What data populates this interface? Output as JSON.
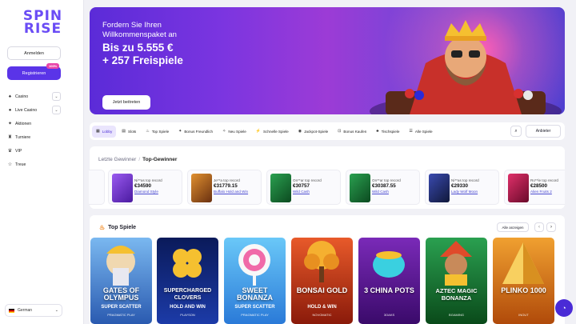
{
  "brand": {
    "line1": "SPIN",
    "line2": "RISE"
  },
  "auth": {
    "login": "Anmelden",
    "register": "Registrieren",
    "register_badge": "100%"
  },
  "nav": [
    {
      "label": "Casino",
      "icon": "spade-icon",
      "expand": true
    },
    {
      "label": "Live Casino",
      "icon": "live-icon",
      "expand": true
    },
    {
      "label": "Aktionen",
      "icon": "gift-icon",
      "expand": false
    },
    {
      "label": "Turniere",
      "icon": "trophy-icon",
      "expand": false
    },
    {
      "label": "VIP",
      "icon": "crown-icon",
      "expand": false
    },
    {
      "label": "Treue",
      "icon": "star-icon",
      "expand": false
    }
  ],
  "language": "German",
  "banner": {
    "title": "Fordern Sie Ihren Willkommenspaket an",
    "line1": "Bis zu 5.555 €",
    "line2": "+ 257 Freispiele",
    "cta": "Jetzt beitreten"
  },
  "tabs": [
    {
      "label": "Lobby",
      "icon": "grid-icon",
      "active": true
    },
    {
      "label": "Slots",
      "icon": "slots-icon",
      "active": false
    },
    {
      "label": "Top Spiele",
      "icon": "fire-icon",
      "active": false
    },
    {
      "label": "Bonus Freundlich",
      "icon": "gift-icon",
      "active": false
    },
    {
      "label": "Neu Spiele",
      "icon": "sparkle-icon",
      "active": false
    },
    {
      "label": "Schnelle Spiele",
      "icon": "bolt-icon",
      "active": false
    },
    {
      "label": "Jackpot-Spiele",
      "icon": "coin-icon",
      "active": false
    },
    {
      "label": "Bonus Kaufen",
      "icon": "cart-icon",
      "active": false
    },
    {
      "label": "Tischspiele",
      "icon": "cards-icon",
      "active": false
    },
    {
      "label": "Alle Spiele",
      "icon": "list-icon",
      "active": false
    }
  ],
  "providers_label": "Anbieter",
  "winners": {
    "tab_recent": "Letzte Gewinner",
    "tab_top": "Top-Gewinner",
    "items": [
      {
        "user": "Ni**as top record",
        "amount": "€34590",
        "game": "Diamond Style",
        "color": "#7a3be0"
      },
      {
        "user": "Je**a top record",
        "amount": "€31779.15",
        "game": "Buffalo Hold and Win",
        "color": "#c06a1a"
      },
      {
        "user": "On**ar top record",
        "amount": "€30757",
        "game": "Wild Cash",
        "color": "#1d7a3a"
      },
      {
        "user": "On**ar top record",
        "amount": "€30387.55",
        "game": "Wild Cash",
        "color": "#1d7a3a"
      },
      {
        "user": "Ni**as top record",
        "amount": "€29330",
        "game": "Lady Wolf Moon",
        "color": "#28307a"
      },
      {
        "user": "Ro**le top record",
        "amount": "€28500",
        "game": "Alien Fruits 2",
        "color": "#b0204a"
      }
    ]
  },
  "top_games": {
    "title": "Top Spiele",
    "show_all": "Alle anzeigen",
    "items": [
      {
        "title": "GATES OF OLYMPUS",
        "sub": "SUPER SCATTER",
        "provider": "PRAGMATIC PLAY",
        "bg": "#3e7fd6"
      },
      {
        "title": "SUPERCHARGED CLOVERS",
        "sub": "HOLD AND WIN",
        "provider": "PLAYSON",
        "bg": "#1c3ba8"
      },
      {
        "title": "SWEET BONANZA",
        "sub": "SUPER SCATTER",
        "provider": "PRAGMATIC PLAY",
        "bg": "#3fa0e8"
      },
      {
        "title": "BONSAI GOLD",
        "sub": "HOLD & WIN",
        "provider": "NOVOMATIC",
        "bg": "#c8421c"
      },
      {
        "title": "3 CHINA POTS",
        "sub": "",
        "provider": "3OAKS",
        "bg": "#5a1f8a"
      },
      {
        "title": "AZTEC MAGIC BONANZA",
        "sub": "",
        "provider": "BGAMING",
        "bg": "#1e7a3c"
      },
      {
        "title": "PLINKO 1000",
        "sub": "",
        "provider": "INOUT",
        "bg": "#e0861e"
      }
    ]
  },
  "colors": {
    "accent": "#5a34e8",
    "badge": "#e845a8"
  }
}
